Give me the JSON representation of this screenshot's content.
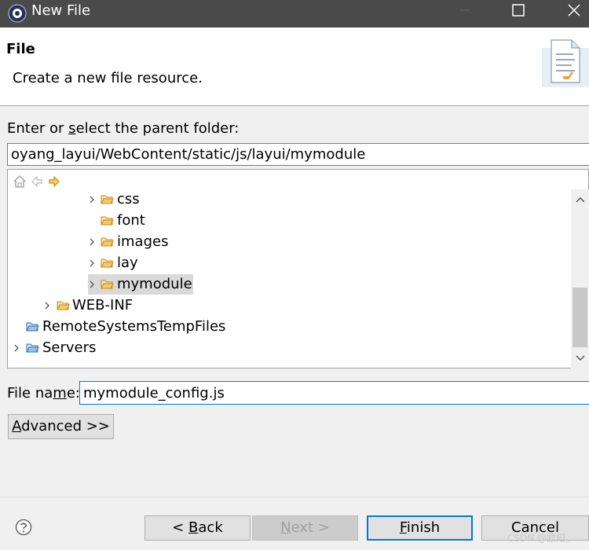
{
  "window": {
    "title": "New File"
  },
  "header": {
    "title": "File",
    "description": "Create a new file resource."
  },
  "parent_folder": {
    "label_before": "Enter or ",
    "label_accel": "s",
    "label_after": "elect the parent folder:",
    "value": "oyang_layui/WebContent/static/js/layui/mymodule"
  },
  "tree": {
    "items": [
      {
        "label": "css"
      },
      {
        "label": "font"
      },
      {
        "label": "images"
      },
      {
        "label": "lay"
      },
      {
        "label": "mymodule",
        "selected": true
      },
      {
        "label": "WEB-INF"
      },
      {
        "label": "RemoteSystemsTempFiles"
      },
      {
        "label": "Servers"
      }
    ]
  },
  "file_name": {
    "label_before": "File na",
    "label_accel": "m",
    "label_after": "e:",
    "value": "mymodule_config.js"
  },
  "buttons": {
    "advanced_accel": "A",
    "advanced_rest": "dvanced >>",
    "back_prefix": "< ",
    "back_accel": "B",
    "back_rest": "ack",
    "next_accel": "N",
    "next_rest": "ext >",
    "finish_accel": "F",
    "finish_rest": "inish",
    "cancel": "Cancel"
  },
  "watermark": "CSDN @欧阳。",
  "colors": {
    "titlebar": "#4a4a4a",
    "accent": "#0078d7",
    "folder": "#e8a33c"
  }
}
